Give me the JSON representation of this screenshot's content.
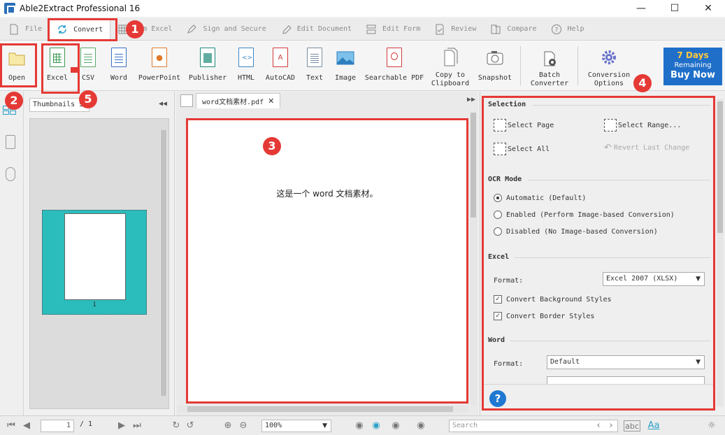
{
  "app": {
    "title": "Able2Extract Professional 16"
  },
  "window_controls": {
    "minimize": "—",
    "maximize": "☐",
    "close": "✕"
  },
  "menu": {
    "items": [
      {
        "label": "File",
        "icon": "file-icon"
      },
      {
        "label": "Convert",
        "icon": "refresh-icon",
        "active": true
      },
      {
        "label": "Custom Excel",
        "visible_label": "tom Excel",
        "icon": "grid-icon"
      },
      {
        "label": "Sign and Secure",
        "icon": "pen-icon"
      },
      {
        "label": "Edit Document",
        "icon": "edit-icon"
      },
      {
        "label": "Edit Form",
        "icon": "form-icon"
      },
      {
        "label": "Review",
        "icon": "checkdoc-icon"
      },
      {
        "label": "Compare",
        "icon": "compare-icon"
      },
      {
        "label": "Help",
        "icon": "help-icon"
      }
    ]
  },
  "toolbar": {
    "open": "Open",
    "excel": "Excel",
    "csv": "CSV",
    "word": "Word",
    "powerpoint": "PowerPoint",
    "publisher": "Publisher",
    "html": "HTML",
    "autocad": "AutoCAD",
    "text": "Text",
    "image": "Image",
    "searchable_pdf": "Searchable PDF",
    "copy_to": "Copy to",
    "clipboard": "Clipboard",
    "snapshot": "Snapshot",
    "batch": "Batch",
    "converter": "Converter",
    "conversion": "Conversion",
    "options": "Options",
    "buy_line1": "7 Days",
    "buy_line2": "Remaining",
    "buy_line3": "Buy Now"
  },
  "thumbnails": {
    "select_value": "Thumbnails",
    "page_number": "1"
  },
  "document": {
    "tab_name": "word文档素材.pdf",
    "content": "这是一个 word 文档素材。"
  },
  "panel": {
    "selection_title": "Selection",
    "select_page": "Select Page",
    "select_range": "Select Range...",
    "select_all": "Select All",
    "revert": "Revert Last Change",
    "ocr_title": "OCR Mode",
    "ocr_auto": "Automatic (Default)",
    "ocr_enabled": "Enabled (Perform Image-based Conversion)",
    "ocr_disabled": "Disabled (No Image-based Conversion)",
    "excel_title": "Excel",
    "format_label": "Format:",
    "excel_format": "Excel 2007 (XLSX)",
    "bg_styles": "Convert Background Styles",
    "border_styles": "Convert Border Styles",
    "word_title": "Word",
    "word_format": "Default",
    "help": "?"
  },
  "statusbar": {
    "page_current": "1",
    "page_total": "/ 1",
    "zoom": "100%",
    "search_placeholder": "Search"
  },
  "annotations": [
    "1",
    "2",
    "3",
    "4",
    "5"
  ],
  "colors": {
    "highlight": "#e53935",
    "accent": "#1f6fc9",
    "thumb_bg": "#2bbcbc"
  }
}
